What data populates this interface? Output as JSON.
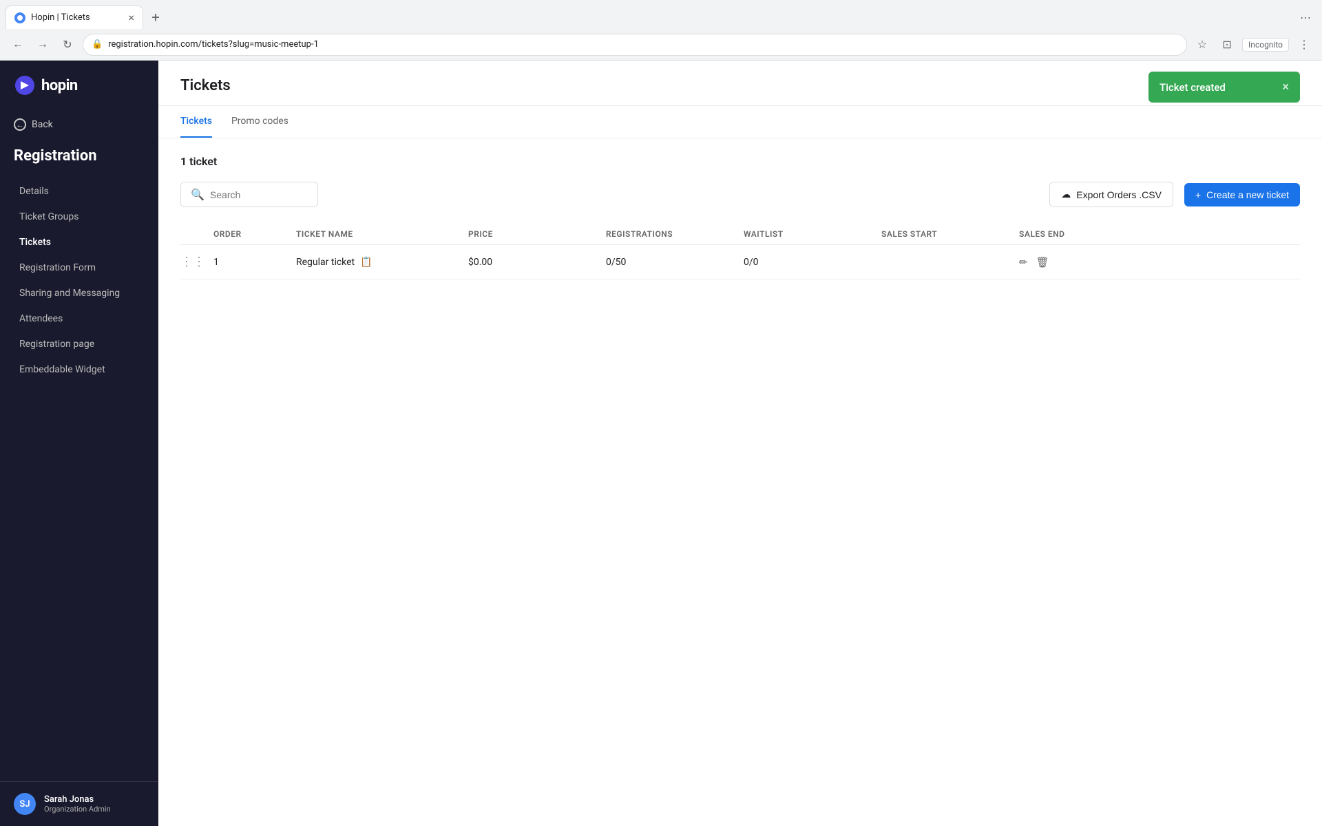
{
  "browser": {
    "tab_title": "Hopin | Tickets",
    "url": "registration.hopin.com/tickets?slug=music-meetup-1",
    "incognito_label": "Incognito"
  },
  "sidebar": {
    "logo_text": "hopin",
    "back_label": "Back",
    "section_title": "Registration",
    "nav_items": [
      {
        "id": "details",
        "label": "Details"
      },
      {
        "id": "ticket-groups",
        "label": "Ticket Groups"
      },
      {
        "id": "tickets",
        "label": "Tickets",
        "active": true
      },
      {
        "id": "registration-form",
        "label": "Registration Form"
      },
      {
        "id": "sharing-messaging",
        "label": "Sharing and Messaging"
      },
      {
        "id": "attendees",
        "label": "Attendees"
      },
      {
        "id": "registration-page",
        "label": "Registration page"
      },
      {
        "id": "embeddable-widget",
        "label": "Embeddable Widget"
      }
    ],
    "user": {
      "initials": "SJ",
      "name": "Sarah Jonas",
      "role": "Organization Admin"
    }
  },
  "page": {
    "title": "Tickets"
  },
  "toast": {
    "message": "Ticket created",
    "close_symbol": "×"
  },
  "tabs": [
    {
      "id": "tickets",
      "label": "Tickets",
      "active": true
    },
    {
      "id": "promo-codes",
      "label": "Promo codes",
      "active": false
    }
  ],
  "content": {
    "ticket_count_label": "1 ticket",
    "search_placeholder": "Search",
    "export_btn_label": "Export Orders .CSV",
    "create_btn_label": "Create a new ticket",
    "table": {
      "columns": [
        "ORDER",
        "TICKET NAME",
        "PRICE",
        "REGISTRATIONS",
        "WAITLIST",
        "SALES START",
        "SALES END"
      ],
      "rows": [
        {
          "order": "1",
          "ticket_name": "Regular ticket",
          "price": "$0.00",
          "registrations": "0/50",
          "waitlist": "0/0",
          "sales_start": "",
          "sales_end": ""
        }
      ]
    }
  }
}
